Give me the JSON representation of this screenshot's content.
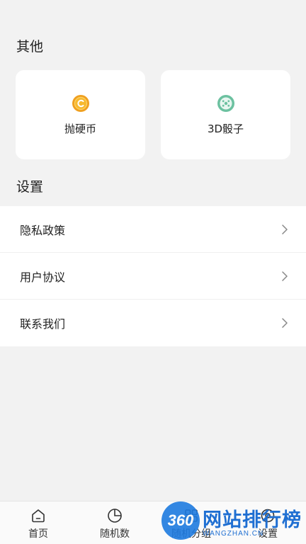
{
  "sections": {
    "other_title": "其他",
    "settings_title": "设置"
  },
  "cards": [
    {
      "label": "抛硬币",
      "icon": "coin-icon",
      "color": "#f0a020"
    },
    {
      "label": "3D骰子",
      "icon": "dice-icon",
      "color": "#6cc1a0"
    }
  ],
  "settings": [
    {
      "label": "隐私政策"
    },
    {
      "label": "用户协议"
    },
    {
      "label": "联系我们"
    }
  ],
  "tabs": [
    {
      "label": "首页",
      "icon": "home-icon"
    },
    {
      "label": "随机数",
      "icon": "pie-chart-icon"
    },
    {
      "label": "随机分组",
      "icon": "grid-icon"
    },
    {
      "label": "设置",
      "icon": "settings-icon"
    }
  ],
  "watermark": {
    "badge": "360",
    "text": "网站排行榜",
    "subtext": "WANGZHAN.CN"
  }
}
